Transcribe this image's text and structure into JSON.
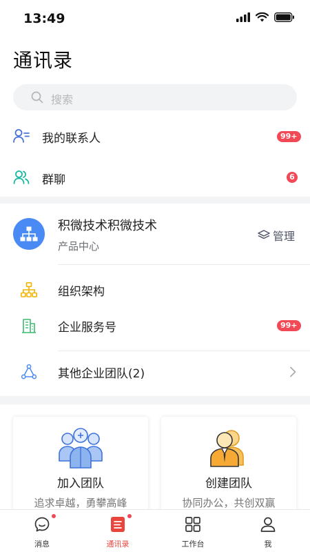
{
  "status_bar": {
    "time": "13:49"
  },
  "page_title": "通讯录",
  "search": {
    "placeholder": "搜索"
  },
  "quick_list": [
    {
      "label": "我的联系人",
      "badge": "99+",
      "icon": "contacts-icon"
    },
    {
      "label": "群聊",
      "badge": "6",
      "icon": "group-chat-icon"
    }
  ],
  "organization": {
    "name": "积微技术积微技术",
    "department": "产品中心",
    "manage_label": "管理",
    "items": [
      {
        "label": "组织架构",
        "icon": "org-structure-icon"
      },
      {
        "label": "企业服务号",
        "badge": "99+",
        "icon": "building-icon"
      }
    ],
    "other_teams_label": "其他企业团队(2)"
  },
  "cards": [
    {
      "title": "加入团队",
      "subtitle": "追求卓越，勇攀高峰"
    },
    {
      "title": "创建团队",
      "subtitle": "协同办公，共创双赢"
    }
  ],
  "tabbar": [
    {
      "label": "消息",
      "icon": "message-icon",
      "has_dot": true
    },
    {
      "label": "通讯录",
      "icon": "contacts-book-icon",
      "has_dot": true,
      "active": true
    },
    {
      "label": "工作台",
      "icon": "workbench-icon",
      "has_dot": false
    },
    {
      "label": "我",
      "icon": "profile-icon",
      "has_dot": false
    }
  ],
  "colors": {
    "accent": "#e8453c",
    "brand_blue": "#4a8af4",
    "badge_red": "#f24957"
  }
}
